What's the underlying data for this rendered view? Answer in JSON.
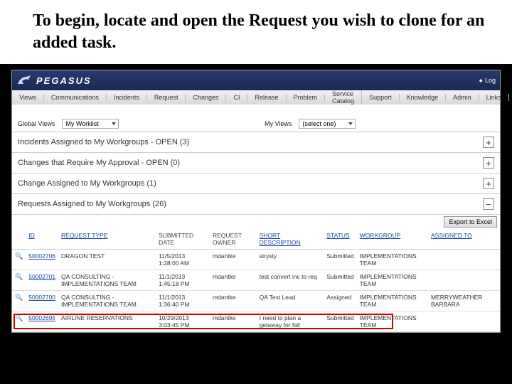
{
  "instruction": "To begin, locate and open the Request you wish to clone for an added task.",
  "brand": "PEGASUS",
  "banner_right": "Log",
  "menu": [
    "Views",
    "Communications",
    "Incidents",
    "Request",
    "Changes",
    "CI",
    "Release",
    "Problem",
    "Service Catalog",
    "Support",
    "Knowledge",
    "Admin",
    "Links"
  ],
  "filters": {
    "global_label": "Global Views",
    "global_value": "My Worklist",
    "myviews_label": "My Views",
    "myviews_value": "(select one)"
  },
  "sections": [
    {
      "title": "Incidents Assigned to My Workgroups - OPEN (3)",
      "state": "plus"
    },
    {
      "title": "Changes that Require My Approval - OPEN (0)",
      "state": "plus"
    },
    {
      "title": "Change Assigned to My Workgroups (1)",
      "state": "plus"
    },
    {
      "title": "Requests Assigned to My Workgroups (26)",
      "state": "minus"
    }
  ],
  "export_label": "Export to Excel",
  "columns": {
    "id": "ID",
    "type": "REQUEST TYPE",
    "submitted": "SUBMITTED DATE",
    "owner": "REQUEST OWNER",
    "desc": "SHORT DESCRIPTION",
    "status": "STATUS",
    "workgroup": "WORKGROUP",
    "assigned": "ASSIGNED TO"
  },
  "rows": [
    {
      "id": "50002706",
      "type": "DRAGON TEST",
      "submitted": "11/5/2013 1:28:00 AM",
      "owner": "mdantke",
      "desc": "strysty",
      "status": "Submitted",
      "workgroup": "IMPLEMENTATIONS TEAM",
      "assigned": ""
    },
    {
      "id": "50002701",
      "type": "QA CONSULTING - IMPLEMENTATIONS TEAM",
      "submitted": "11/1/2013 1:45:18 PM",
      "owner": "mdantke",
      "desc": "test convert inc to req",
      "status": "Submitted",
      "workgroup": "IMPLEMENTATIONS TEAM",
      "assigned": ""
    },
    {
      "id": "50002700",
      "type": "QA CONSULTING - IMPLEMENTATIONS TEAM",
      "submitted": "11/1/2013 1:36:40 PM",
      "owner": "mdantke",
      "desc": "QA Test Lead",
      "status": "Assigned",
      "workgroup": "IMPLEMENTATIONS TEAM",
      "assigned": "MERRYWEATHER BARBARA"
    },
    {
      "id": "50002695",
      "type": "AIRLINE RESERVATIONS",
      "submitted": "10/29/2013 3:03:45 PM",
      "owner": "mdantke",
      "desc": "I need to plan a getaway for fall",
      "status": "Submitted",
      "workgroup": "IMPLEMENTATIONS TEAM",
      "assigned": ""
    }
  ]
}
